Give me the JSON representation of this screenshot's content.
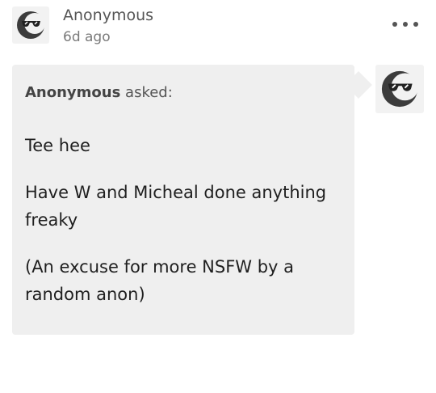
{
  "post": {
    "author": "Anonymous",
    "time": "6d ago",
    "more_icon": "more-horizontal-icon",
    "avatar_icon": "anonymous-sunglasses-avatar"
  },
  "ask": {
    "asker_name": "Anonymous",
    "asked_label": "asked:",
    "paragraphs": [
      "Tee hee",
      "Have W and Micheal done anything freaky",
      "(An excuse for more NSFW by a random anon)"
    ],
    "avatar_icon": "anonymous-sunglasses-avatar"
  },
  "colors": {
    "bubble_bg": "#efefef",
    "avatar_bg": "#f2f2f2",
    "avatar_circle": "#3c3c3c",
    "muted_text": "#555555"
  }
}
